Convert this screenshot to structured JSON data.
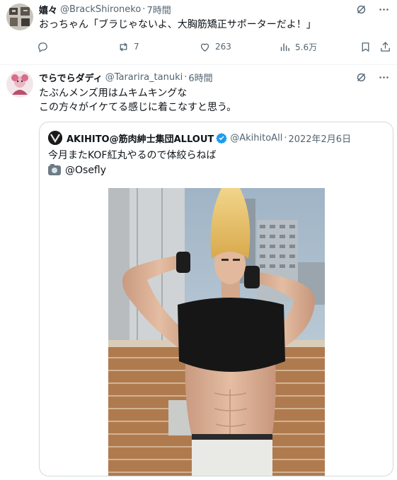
{
  "tweet1": {
    "name": "嬉々",
    "handle": "@BrackShironeko",
    "time": "7時間",
    "text": "おっちゃん「ブラじゃないよ、大胸筋矯正サポーターだよ！」",
    "replies": "",
    "retweets": "7",
    "likes": "263",
    "views": "5.6万"
  },
  "tweet2": {
    "name": "でらでらダディ",
    "handle": "@Tararira_tanuki",
    "time": "6時間",
    "text_line1": "たぶんメンズ用はムキムキングな",
    "text_line2": "この方々がイケてる感じに着こなすと思う。"
  },
  "quote": {
    "name": "AKIHITO@筋肉紳士集団ALLOUT",
    "handle": "@AkihitoAll",
    "date": "2022年2月6日",
    "text": "今月またKOF紅丸やるので体絞らねば",
    "credit": "@Osefly"
  },
  "icons": [
    "reply-icon",
    "retweet-icon",
    "like-icon",
    "views-icon",
    "bookmark-icon",
    "share-icon",
    "grok-icon",
    "more-icon",
    "verified-icon",
    "camera-icon"
  ],
  "colors": {
    "text": "#0f1419",
    "muted": "#536471",
    "border": "#cfd9de",
    "verified": "#1d9bf0"
  }
}
